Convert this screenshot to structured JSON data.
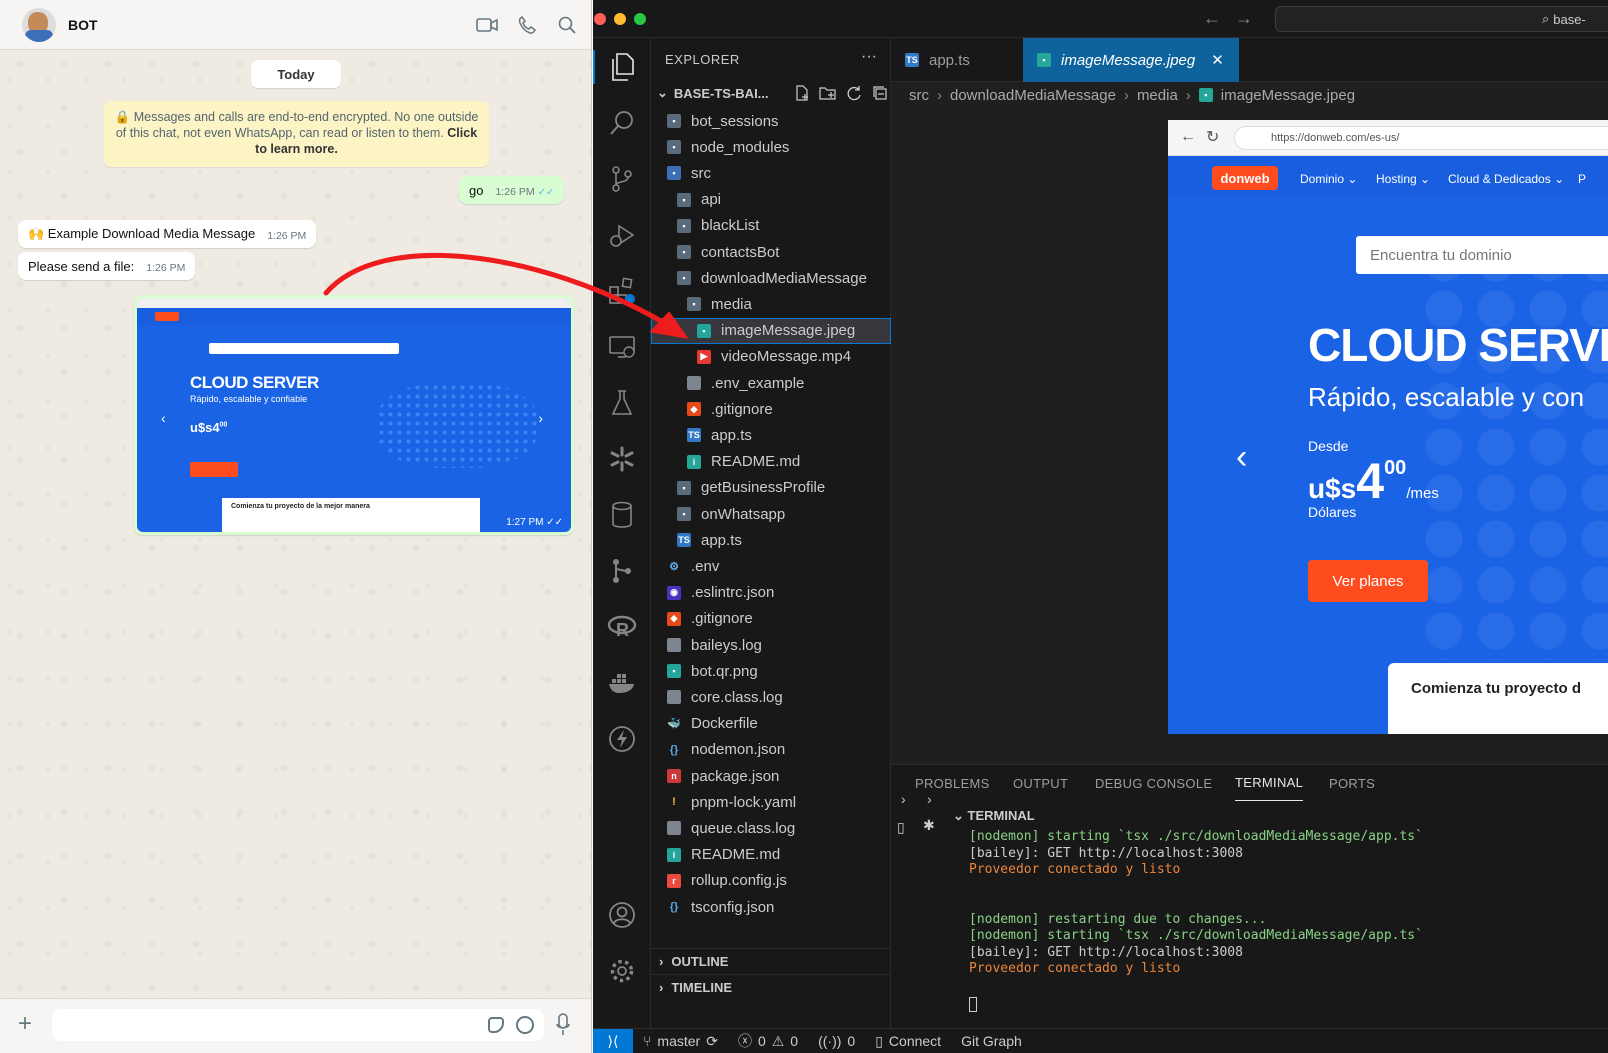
{
  "whatsapp": {
    "contact_name": "BOT",
    "date_chip": "Today",
    "encryption_notice": "Messages and calls are end-to-end encrypted. No one outside of this chat, not even WhatsApp, can read or listen to them.",
    "encryption_link": "Click to learn more.",
    "messages": [
      {
        "direction": "out",
        "text": "go",
        "time": "1:26 PM"
      },
      {
        "direction": "in",
        "text": "🙌 Example Download Media Message",
        "time": "1:26 PM"
      },
      {
        "direction": "in",
        "text": "Please send a file:",
        "time": "1:26 PM"
      },
      {
        "direction": "out",
        "type": "image",
        "time": "1:27 PM"
      }
    ],
    "image_preview": {
      "title": "CLOUD SERVER",
      "subtitle": "Rápido, escalable y confiable",
      "price": "u$s4",
      "price_cents": "00",
      "card_text": "Comienza tu proyecto de la mejor manera"
    },
    "icons": [
      "video-call-icon",
      "phone-icon",
      "search-icon",
      "plus-icon",
      "sticker-icon",
      "emoji-icon",
      "mic-icon"
    ]
  },
  "vscode": {
    "search_text": "base-",
    "explorer_title": "EXPLORER",
    "project_name": "BASE-TS-BAI...",
    "tree": [
      {
        "label": "bot_sessions",
        "kind": "folder",
        "depth": 0
      },
      {
        "label": "node_modules",
        "kind": "folder-node",
        "depth": 0
      },
      {
        "label": "src",
        "kind": "folder-src",
        "depth": 0
      },
      {
        "label": "api",
        "kind": "folder",
        "depth": 1
      },
      {
        "label": "blackList",
        "kind": "folder",
        "depth": 1
      },
      {
        "label": "contactsBot",
        "kind": "folder",
        "depth": 1
      },
      {
        "label": "downloadMediaMessage",
        "kind": "folder",
        "depth": 1
      },
      {
        "label": "media",
        "kind": "folder",
        "depth": 2
      },
      {
        "label": "imageMessage.jpeg",
        "kind": "image",
        "depth": 3,
        "selected": true
      },
      {
        "label": "videoMessage.mp4",
        "kind": "video",
        "depth": 3
      },
      {
        "label": ".env_example",
        "kind": "file",
        "depth": 2
      },
      {
        "label": ".gitignore",
        "kind": "git",
        "depth": 2
      },
      {
        "label": "app.ts",
        "kind": "ts",
        "depth": 2
      },
      {
        "label": "README.md",
        "kind": "info",
        "depth": 2
      },
      {
        "label": "getBusinessProfile",
        "kind": "folder",
        "depth": 1
      },
      {
        "label": "onWhatsapp",
        "kind": "folder",
        "depth": 1
      },
      {
        "label": "app.ts",
        "kind": "ts",
        "depth": 1
      },
      {
        "label": ".env",
        "kind": "gear",
        "depth": 0
      },
      {
        "label": ".eslintrc.json",
        "kind": "eslint",
        "depth": 0
      },
      {
        "label": ".gitignore",
        "kind": "git",
        "depth": 0
      },
      {
        "label": "baileys.log",
        "kind": "file",
        "depth": 0
      },
      {
        "label": "bot.qr.png",
        "kind": "image",
        "depth": 0
      },
      {
        "label": "core.class.log",
        "kind": "file",
        "depth": 0
      },
      {
        "label": "Dockerfile",
        "kind": "docker",
        "depth": 0
      },
      {
        "label": "nodemon.json",
        "kind": "json",
        "depth": 0
      },
      {
        "label": "package.json",
        "kind": "npm",
        "depth": 0
      },
      {
        "label": "pnpm-lock.yaml",
        "kind": "yaml",
        "depth": 0
      },
      {
        "label": "queue.class.log",
        "kind": "file",
        "depth": 0
      },
      {
        "label": "README.md",
        "kind": "info",
        "depth": 0
      },
      {
        "label": "rollup.config.js",
        "kind": "rollup",
        "depth": 0
      },
      {
        "label": "tsconfig.json",
        "kind": "json",
        "depth": 0
      }
    ],
    "sections": {
      "outline": "OUTLINE",
      "timeline": "TIMELINE"
    },
    "tabs": [
      {
        "label": "app.ts",
        "active": false
      },
      {
        "label": "imageMessage.jpeg",
        "active": true
      }
    ],
    "breadcrumb": [
      "src",
      "downloadMediaMessage",
      "media",
      "imageMessage.jpeg"
    ],
    "preview": {
      "url": "https://donweb.com/es-us/",
      "logo": "donweb",
      "menu": [
        "Dominio",
        "Hosting",
        "Cloud & Dedicados",
        "P"
      ],
      "search_placeholder": "Encuentra tu dominio",
      "title": "CLOUD SERVE",
      "subtitle": "Rápido, escalable y con",
      "desde": "Desde",
      "currency": "u$s",
      "price_int": "4",
      "price_dec": "00",
      "per": "/mes",
      "dolares": "Dólares",
      "cta": "Ver planes",
      "card": "Comienza tu proyecto d"
    },
    "panel_tabs": [
      {
        "label": "PROBLEMS",
        "active": false
      },
      {
        "label": "OUTPUT",
        "active": false
      },
      {
        "label": "DEBUG CONSOLE",
        "active": false
      },
      {
        "label": "TERMINAL",
        "active": true
      },
      {
        "label": "PORTS",
        "active": false
      }
    ],
    "terminal_title": "TERMINAL",
    "terminal_lines": [
      {
        "text": "[nodemon] starting `tsx ./src/downloadMediaMessage/app.ts`",
        "color": "green"
      },
      {
        "text": "[bailey]: GET http://localhost:3008",
        "color": "white"
      },
      {
        "text": "Proveedor conectado y listo",
        "color": "orange"
      },
      {
        "text": "",
        "color": "white"
      },
      {
        "text": "",
        "color": "white"
      },
      {
        "text": "[nodemon] restarting due to changes...",
        "color": "green"
      },
      {
        "text": "[nodemon] starting `tsx ./src/downloadMediaMessage/app.ts`",
        "color": "green"
      },
      {
        "text": "[bailey]: GET http://localhost:3008",
        "color": "white"
      },
      {
        "text": "Proveedor conectado y listo",
        "color": "orange"
      }
    ],
    "status": {
      "branch": "master",
      "errors": "0",
      "warnings": "0",
      "ports": "0",
      "connect": "Connect",
      "git_graph": "Git Graph"
    },
    "colors": {
      "accent": "#0078d4",
      "active_tab": "#0e639c",
      "brand_orange": "#ff4c1e",
      "site_blue": "#1b63e5"
    }
  }
}
